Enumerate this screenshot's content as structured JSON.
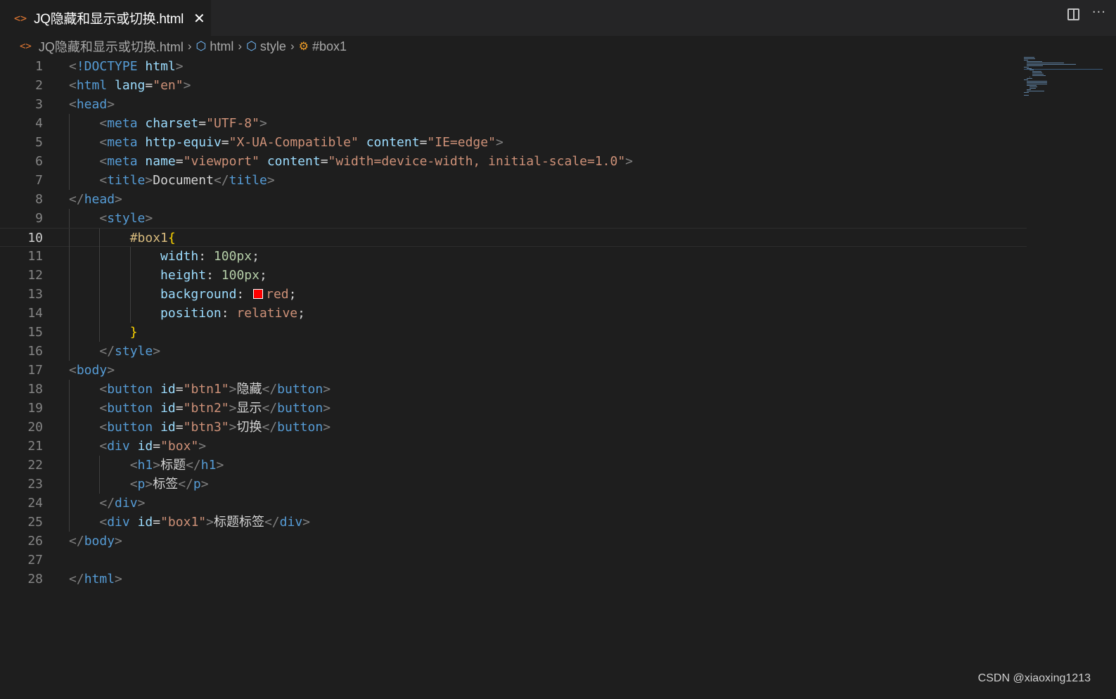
{
  "tab": {
    "icon": "html-code-icon",
    "label": "JQ隐藏和显示或切换.html",
    "close": "✕"
  },
  "editor_actions": {
    "split": "split-editor-icon",
    "more": "···"
  },
  "breadcrumb": {
    "file": "JQ隐藏和显示或切换.html",
    "items": [
      "html",
      "style",
      "#box1"
    ]
  },
  "editor": {
    "current_line": 10,
    "lines": [
      {
        "n": "1",
        "tokens": [
          [
            "punc",
            "<"
          ],
          [
            "tag",
            "!DOCTYPE"
          ],
          [
            "text",
            " "
          ],
          [
            "attr",
            "html"
          ],
          [
            "punc",
            ">"
          ]
        ]
      },
      {
        "n": "2",
        "tokens": [
          [
            "punc",
            "<"
          ],
          [
            "tag",
            "html"
          ],
          [
            "text",
            " "
          ],
          [
            "attr",
            "lang"
          ],
          [
            "text",
            "="
          ],
          [
            "str",
            "\"en\""
          ],
          [
            "punc",
            ">"
          ]
        ]
      },
      {
        "n": "3",
        "tokens": [
          [
            "punc",
            "<"
          ],
          [
            "tag",
            "head"
          ],
          [
            "punc",
            ">"
          ]
        ]
      },
      {
        "n": "4",
        "tokens": [
          [
            "text",
            "    "
          ],
          [
            "punc",
            "<"
          ],
          [
            "tag",
            "meta"
          ],
          [
            "text",
            " "
          ],
          [
            "attr",
            "charset"
          ],
          [
            "text",
            "="
          ],
          [
            "str",
            "\"UTF-8\""
          ],
          [
            "punc",
            ">"
          ]
        ]
      },
      {
        "n": "5",
        "tokens": [
          [
            "text",
            "    "
          ],
          [
            "punc",
            "<"
          ],
          [
            "tag",
            "meta"
          ],
          [
            "text",
            " "
          ],
          [
            "attr",
            "http-equiv"
          ],
          [
            "text",
            "="
          ],
          [
            "str",
            "\"X-UA-Compatible\""
          ],
          [
            "text",
            " "
          ],
          [
            "attr",
            "content"
          ],
          [
            "text",
            "="
          ],
          [
            "str",
            "\"IE=edge\""
          ],
          [
            "punc",
            ">"
          ]
        ]
      },
      {
        "n": "6",
        "tokens": [
          [
            "text",
            "    "
          ],
          [
            "punc",
            "<"
          ],
          [
            "tag",
            "meta"
          ],
          [
            "text",
            " "
          ],
          [
            "attr",
            "name"
          ],
          [
            "text",
            "="
          ],
          [
            "str",
            "\"viewport\""
          ],
          [
            "text",
            " "
          ],
          [
            "attr",
            "content"
          ],
          [
            "text",
            "="
          ],
          [
            "str",
            "\"width=device-width, initial-scale=1.0\""
          ],
          [
            "punc",
            ">"
          ]
        ]
      },
      {
        "n": "7",
        "tokens": [
          [
            "text",
            "    "
          ],
          [
            "punc",
            "<"
          ],
          [
            "tag",
            "title"
          ],
          [
            "punc",
            ">"
          ],
          [
            "text",
            "Document"
          ],
          [
            "punc",
            "</"
          ],
          [
            "tag",
            "title"
          ],
          [
            "punc",
            ">"
          ]
        ]
      },
      {
        "n": "8",
        "tokens": [
          [
            "punc",
            "</"
          ],
          [
            "tag",
            "head"
          ],
          [
            "punc",
            ">"
          ]
        ]
      },
      {
        "n": "9",
        "tokens": [
          [
            "text",
            "    "
          ],
          [
            "punc",
            "<"
          ],
          [
            "tag",
            "style"
          ],
          [
            "punc",
            ">"
          ]
        ]
      },
      {
        "n": "10",
        "tokens": [
          [
            "text",
            "        "
          ],
          [
            "sel",
            "#box1"
          ],
          [
            "brace",
            "{"
          ]
        ]
      },
      {
        "n": "11",
        "tokens": [
          [
            "text",
            "            "
          ],
          [
            "prop",
            "width"
          ],
          [
            "text",
            ": "
          ],
          [
            "num",
            "100px"
          ],
          [
            "text",
            ";"
          ]
        ]
      },
      {
        "n": "12",
        "tokens": [
          [
            "text",
            "            "
          ],
          [
            "prop",
            "height"
          ],
          [
            "text",
            ": "
          ],
          [
            "num",
            "100px"
          ],
          [
            "text",
            ";"
          ]
        ]
      },
      {
        "n": "13",
        "tokens": [
          [
            "text",
            "            "
          ],
          [
            "prop",
            "background"
          ],
          [
            "text",
            ": "
          ],
          [
            "swatch",
            ""
          ],
          [
            "val",
            "red"
          ],
          [
            "text",
            ";"
          ]
        ]
      },
      {
        "n": "14",
        "tokens": [
          [
            "text",
            "            "
          ],
          [
            "prop",
            "position"
          ],
          [
            "text",
            ": "
          ],
          [
            "val",
            "relative"
          ],
          [
            "text",
            ";"
          ]
        ]
      },
      {
        "n": "15",
        "tokens": [
          [
            "text",
            "        "
          ],
          [
            "brace",
            "}"
          ]
        ]
      },
      {
        "n": "16",
        "tokens": [
          [
            "text",
            "    "
          ],
          [
            "punc",
            "</"
          ],
          [
            "tag",
            "style"
          ],
          [
            "punc",
            ">"
          ]
        ]
      },
      {
        "n": "17",
        "tokens": [
          [
            "punc",
            "<"
          ],
          [
            "tag",
            "body"
          ],
          [
            "punc",
            ">"
          ]
        ]
      },
      {
        "n": "18",
        "tokens": [
          [
            "text",
            "    "
          ],
          [
            "punc",
            "<"
          ],
          [
            "tag",
            "button"
          ],
          [
            "text",
            " "
          ],
          [
            "attr",
            "id"
          ],
          [
            "text",
            "="
          ],
          [
            "str",
            "\"btn1\""
          ],
          [
            "punc",
            ">"
          ],
          [
            "text",
            "隐藏"
          ],
          [
            "punc",
            "</"
          ],
          [
            "tag",
            "button"
          ],
          [
            "punc",
            ">"
          ]
        ]
      },
      {
        "n": "19",
        "tokens": [
          [
            "text",
            "    "
          ],
          [
            "punc",
            "<"
          ],
          [
            "tag",
            "button"
          ],
          [
            "text",
            " "
          ],
          [
            "attr",
            "id"
          ],
          [
            "text",
            "="
          ],
          [
            "str",
            "\"btn2\""
          ],
          [
            "punc",
            ">"
          ],
          [
            "text",
            "显示"
          ],
          [
            "punc",
            "</"
          ],
          [
            "tag",
            "button"
          ],
          [
            "punc",
            ">"
          ]
        ]
      },
      {
        "n": "20",
        "tokens": [
          [
            "text",
            "    "
          ],
          [
            "punc",
            "<"
          ],
          [
            "tag",
            "button"
          ],
          [
            "text",
            " "
          ],
          [
            "attr",
            "id"
          ],
          [
            "text",
            "="
          ],
          [
            "str",
            "\"btn3\""
          ],
          [
            "punc",
            ">"
          ],
          [
            "text",
            "切换"
          ],
          [
            "punc",
            "</"
          ],
          [
            "tag",
            "button"
          ],
          [
            "punc",
            ">"
          ]
        ]
      },
      {
        "n": "21",
        "tokens": [
          [
            "text",
            "    "
          ],
          [
            "punc",
            "<"
          ],
          [
            "tag",
            "div"
          ],
          [
            "text",
            " "
          ],
          [
            "attr",
            "id"
          ],
          [
            "text",
            "="
          ],
          [
            "str",
            "\"box\""
          ],
          [
            "punc",
            ">"
          ]
        ]
      },
      {
        "n": "22",
        "tokens": [
          [
            "text",
            "        "
          ],
          [
            "punc",
            "<"
          ],
          [
            "tag",
            "h1"
          ],
          [
            "punc",
            ">"
          ],
          [
            "text",
            "标题"
          ],
          [
            "punc",
            "</"
          ],
          [
            "tag",
            "h1"
          ],
          [
            "punc",
            ">"
          ]
        ]
      },
      {
        "n": "23",
        "tokens": [
          [
            "text",
            "        "
          ],
          [
            "punc",
            "<"
          ],
          [
            "tag",
            "p"
          ],
          [
            "punc",
            ">"
          ],
          [
            "text",
            "标签"
          ],
          [
            "punc",
            "</"
          ],
          [
            "tag",
            "p"
          ],
          [
            "punc",
            ">"
          ]
        ]
      },
      {
        "n": "24",
        "tokens": [
          [
            "text",
            "    "
          ],
          [
            "punc",
            "</"
          ],
          [
            "tag",
            "div"
          ],
          [
            "punc",
            ">"
          ]
        ]
      },
      {
        "n": "25",
        "tokens": [
          [
            "text",
            "    "
          ],
          [
            "punc",
            "<"
          ],
          [
            "tag",
            "div"
          ],
          [
            "text",
            " "
          ],
          [
            "attr",
            "id"
          ],
          [
            "text",
            "="
          ],
          [
            "str",
            "\"box1\""
          ],
          [
            "punc",
            ">"
          ],
          [
            "text",
            "标题标签"
          ],
          [
            "punc",
            "</"
          ],
          [
            "tag",
            "div"
          ],
          [
            "punc",
            ">"
          ]
        ]
      },
      {
        "n": "26",
        "tokens": [
          [
            "punc",
            "</"
          ],
          [
            "tag",
            "body"
          ],
          [
            "punc",
            ">"
          ]
        ]
      },
      {
        "n": "27",
        "tokens": []
      },
      {
        "n": "28",
        "tokens": [
          [
            "punc",
            "</"
          ],
          [
            "tag",
            "html"
          ],
          [
            "punc",
            ">"
          ]
        ]
      }
    ]
  },
  "watermark": "CSDN @xiaoxing1213"
}
